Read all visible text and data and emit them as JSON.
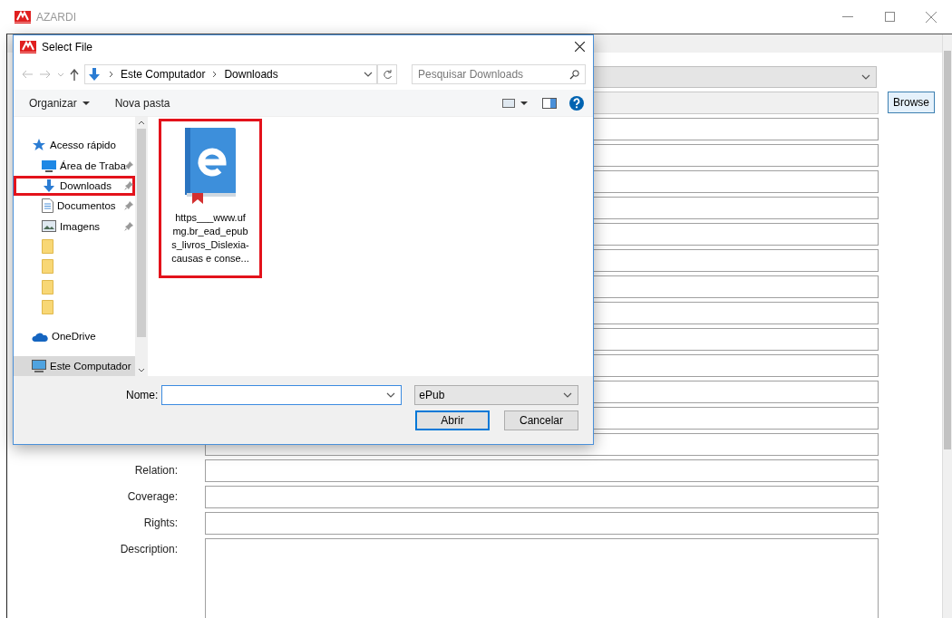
{
  "window": {
    "title": "AZARDI"
  },
  "form": {
    "rows": [
      {
        "kind": "dropdown"
      },
      {
        "kind": "browse",
        "button": "Browse"
      },
      {
        "kind": "text"
      },
      {
        "kind": "text"
      },
      {
        "kind": "text"
      },
      {
        "kind": "text"
      },
      {
        "kind": "text"
      },
      {
        "kind": "text"
      },
      {
        "kind": "text"
      },
      {
        "kind": "text"
      },
      {
        "kind": "text"
      },
      {
        "kind": "text"
      },
      {
        "kind": "text"
      },
      {
        "kind": "text"
      },
      {
        "kind": "text"
      },
      {
        "kind": "text",
        "label": "Relation:"
      },
      {
        "kind": "text",
        "label": "Coverage:"
      },
      {
        "kind": "text",
        "label": "Rights:"
      },
      {
        "kind": "textarea",
        "label": "Description:"
      }
    ]
  },
  "dialog": {
    "title": "Select File",
    "breadcrumb": [
      "Este Computador",
      "Downloads"
    ],
    "search": {
      "placeholder": "Pesquisar Downloads"
    },
    "toolbar": [
      "Organizar",
      "Nova pasta"
    ],
    "nav": [
      {
        "kind": "quick",
        "label": "Acesso rápido",
        "selected": false,
        "highlighted": false
      },
      {
        "kind": "desktop",
        "label": "Área de Traba",
        "pinned": true,
        "selected": false,
        "highlighted": false
      },
      {
        "kind": "downloads",
        "label": "Downloads",
        "pinned": true,
        "selected": false,
        "highlighted": true
      },
      {
        "kind": "documents",
        "label": "Documentos",
        "pinned": true,
        "selected": false,
        "highlighted": false
      },
      {
        "kind": "pictures",
        "label": "Imagens",
        "pinned": true,
        "selected": false,
        "highlighted": false
      },
      {
        "kind": "folder",
        "selected": false,
        "highlighted": false
      },
      {
        "kind": "folder",
        "selected": false,
        "highlighted": false
      },
      {
        "kind": "folder",
        "selected": false,
        "highlighted": false
      },
      {
        "kind": "folder",
        "selected": false,
        "highlighted": false
      },
      {
        "kind": "onedrive",
        "label": "OneDrive",
        "selected": false,
        "highlighted": false
      },
      {
        "kind": "pc",
        "label": "Este Computador",
        "selected": true,
        "highlighted": false
      }
    ],
    "files": [
      {
        "name": "https___www.ufmg.br_ead_epubs_livros_Dislexia-causas e conse...",
        "highlighted": true
      }
    ],
    "name_label": "Nome:",
    "file_type": "ePub",
    "buttons": [
      "Abrir",
      "Cancelar"
    ]
  }
}
